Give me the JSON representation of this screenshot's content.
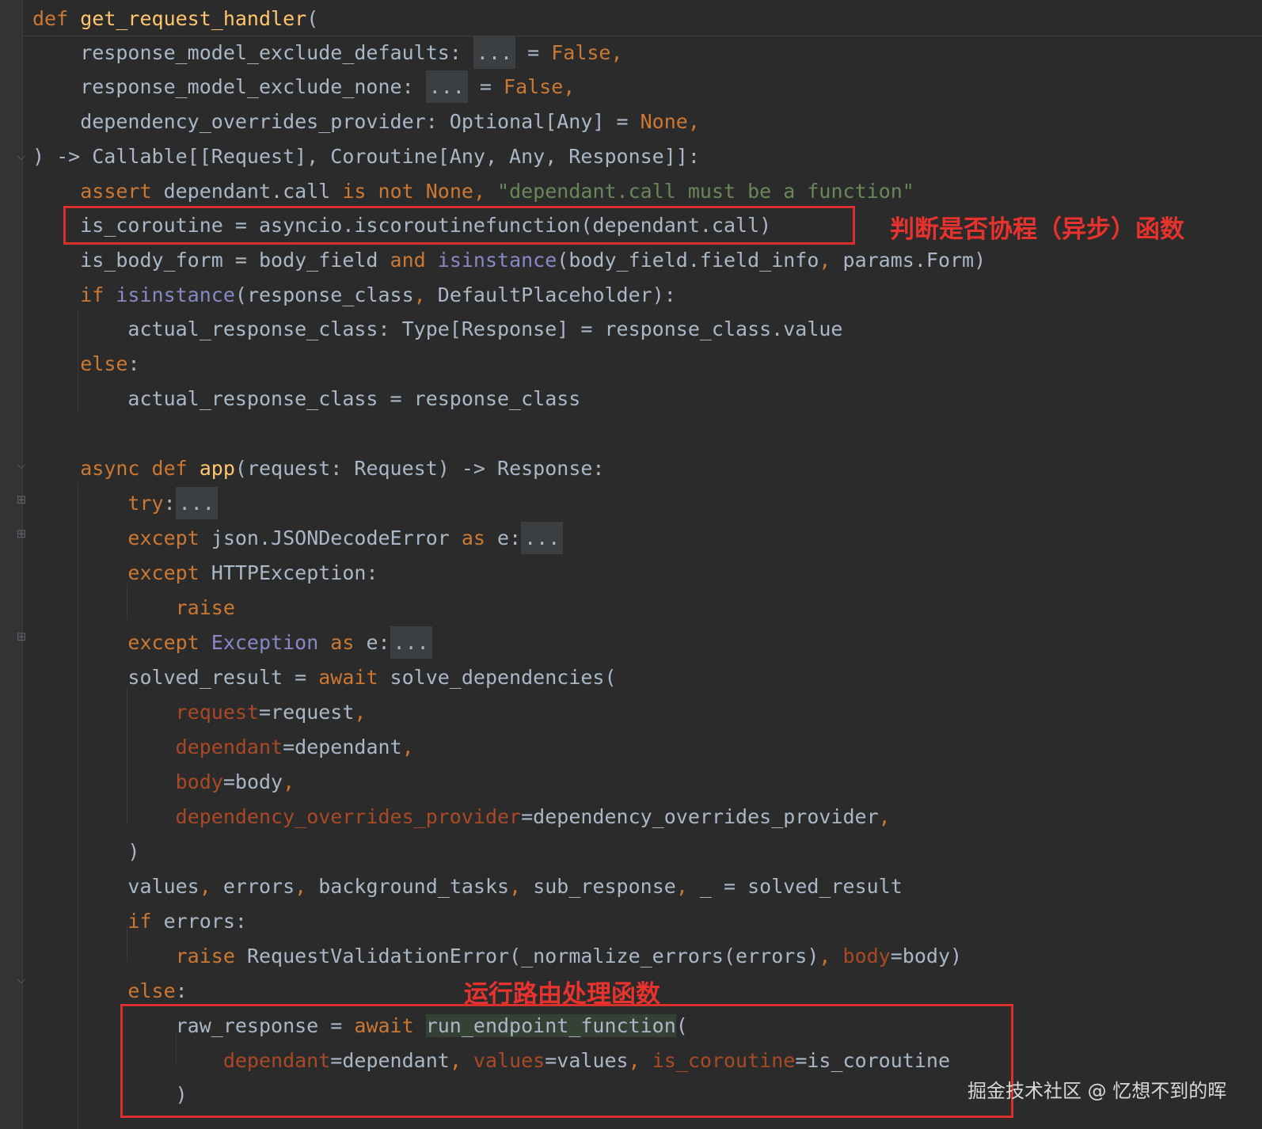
{
  "editor": {
    "lines": [
      [
        [
          "kw",
          "def "
        ],
        [
          "fn",
          "get_request_handler"
        ],
        [
          "text",
          "("
        ]
      ],
      [
        [
          "text",
          "    response_model_exclude_defaults: "
        ],
        [
          "fold",
          "..."
        ],
        [
          "text",
          " = "
        ],
        [
          "kw",
          "False,"
        ]
      ],
      [
        [
          "text",
          "    response_model_exclude_none: "
        ],
        [
          "fold",
          "..."
        ],
        [
          "text",
          " = "
        ],
        [
          "kw",
          "False,"
        ]
      ],
      [
        [
          "text",
          "    dependency_overrides_provider: Optional[Any] = "
        ],
        [
          "kw",
          "None,"
        ]
      ],
      [
        [
          "text",
          ") -> Callable[[Request], Coroutine[Any, Any, Response]]:"
        ]
      ],
      [
        [
          "text",
          "    "
        ],
        [
          "kw",
          "assert "
        ],
        [
          "text",
          "dependant.call "
        ],
        [
          "kw",
          "is not None"
        ],
        [
          "kw",
          ", "
        ],
        [
          "str",
          "\"dependant.call must be a function\""
        ]
      ],
      [
        [
          "text",
          "    is_coroutine = asyncio.iscoroutinefunction(dependant.call)"
        ]
      ],
      [
        [
          "text",
          "    is_body_form = body_field "
        ],
        [
          "kw",
          "and "
        ],
        [
          "builtin",
          "isinstance"
        ],
        [
          "text",
          "(body_field.field_info"
        ],
        [
          "kw",
          ", "
        ],
        [
          "text",
          "params.Form)"
        ]
      ],
      [
        [
          "text",
          "    "
        ],
        [
          "kw",
          "if "
        ],
        [
          "builtin",
          "isinstance"
        ],
        [
          "text",
          "(response_class"
        ],
        [
          "kw",
          ", "
        ],
        [
          "text",
          "DefaultPlaceholder):"
        ]
      ],
      [
        [
          "text",
          "        actual_response_class: Type[Response] = response_class.value"
        ]
      ],
      [
        [
          "text",
          "    "
        ],
        [
          "kw",
          "else"
        ],
        [
          "text",
          ":"
        ]
      ],
      [
        [
          "text",
          "        actual_response_class = response_class"
        ]
      ],
      [],
      [
        [
          "text",
          "    "
        ],
        [
          "kw",
          "async def "
        ],
        [
          "fn",
          "app"
        ],
        [
          "text",
          "(request: Request) -> Response:"
        ]
      ],
      [
        [
          "text",
          "        "
        ],
        [
          "kw",
          "try"
        ],
        [
          "text",
          ":"
        ],
        [
          "fold",
          "..."
        ]
      ],
      [
        [
          "text",
          "        "
        ],
        [
          "kw",
          "except "
        ],
        [
          "text",
          "json.JSONDecodeError "
        ],
        [
          "kw",
          "as "
        ],
        [
          "text",
          "e:"
        ],
        [
          "fold",
          "..."
        ]
      ],
      [
        [
          "text",
          "        "
        ],
        [
          "kw",
          "except "
        ],
        [
          "text",
          "HTTPException:"
        ]
      ],
      [
        [
          "text",
          "            "
        ],
        [
          "kw",
          "raise"
        ]
      ],
      [
        [
          "text",
          "        "
        ],
        [
          "kw",
          "except "
        ],
        [
          "builtin",
          "Exception "
        ],
        [
          "kw",
          "as "
        ],
        [
          "text",
          "e:"
        ],
        [
          "fold",
          "..."
        ]
      ],
      [
        [
          "text",
          "        solved_result = "
        ],
        [
          "kw",
          "await "
        ],
        [
          "text",
          "solve_dependencies("
        ]
      ],
      [
        [
          "text",
          "            "
        ],
        [
          "param",
          "request"
        ],
        [
          "text",
          "=request"
        ],
        [
          "kw",
          ","
        ]
      ],
      [
        [
          "text",
          "            "
        ],
        [
          "param",
          "dependant"
        ],
        [
          "text",
          "=dependant"
        ],
        [
          "kw",
          ","
        ]
      ],
      [
        [
          "text",
          "            "
        ],
        [
          "param",
          "body"
        ],
        [
          "text",
          "=body"
        ],
        [
          "kw",
          ","
        ]
      ],
      [
        [
          "text",
          "            "
        ],
        [
          "param",
          "dependency_overrides_provider"
        ],
        [
          "text",
          "=dependency_overrides_provider"
        ],
        [
          "kw",
          ","
        ]
      ],
      [
        [
          "text",
          "        )"
        ]
      ],
      [
        [
          "text",
          "        values"
        ],
        [
          "kw",
          ", "
        ],
        [
          "text",
          "errors"
        ],
        [
          "kw",
          ", "
        ],
        [
          "text",
          "background_tasks"
        ],
        [
          "kw",
          ", "
        ],
        [
          "text",
          "sub_response"
        ],
        [
          "kw",
          ", "
        ],
        [
          "text",
          "_ = solved_result"
        ]
      ],
      [
        [
          "text",
          "        "
        ],
        [
          "kw",
          "if "
        ],
        [
          "text",
          "errors:"
        ]
      ],
      [
        [
          "text",
          "            "
        ],
        [
          "kw",
          "raise "
        ],
        [
          "text",
          "RequestValidationError(_normalize_errors(errors)"
        ],
        [
          "kw",
          ", "
        ],
        [
          "param",
          "body"
        ],
        [
          "text",
          "=body)"
        ]
      ],
      [
        [
          "text",
          "        "
        ],
        [
          "kw",
          "else"
        ],
        [
          "text",
          ":"
        ]
      ],
      [
        [
          "text",
          "            raw_response = "
        ],
        [
          "kw",
          "await "
        ],
        [
          "hl",
          "run_endpoint_function"
        ],
        [
          "text",
          "("
        ]
      ],
      [
        [
          "text",
          "                "
        ],
        [
          "param",
          "dependant"
        ],
        [
          "text",
          "=dependant"
        ],
        [
          "kw",
          ", "
        ],
        [
          "param",
          "values"
        ],
        [
          "text",
          "=values"
        ],
        [
          "kw",
          ", "
        ],
        [
          "param",
          "is_coroutine"
        ],
        [
          "text",
          "=is_coroutine"
        ]
      ],
      [
        [
          "text",
          "            )"
        ]
      ]
    ]
  },
  "annotations": {
    "coroutine_check_label": "判断是否协程（异步）函数",
    "run_endpoint_label": "运行路由处理函数",
    "box_color": "#d9302c"
  },
  "watermark": "掘金技术社区 @ 忆想不到的晖",
  "syntax_colors": {
    "text": "#a9b7c6",
    "keyword": "#cc7832",
    "function": "#ffc66d",
    "builtin": "#8888c6",
    "string": "#6a8759",
    "named_param": "#aa4926",
    "background": "#2b2b2b"
  }
}
